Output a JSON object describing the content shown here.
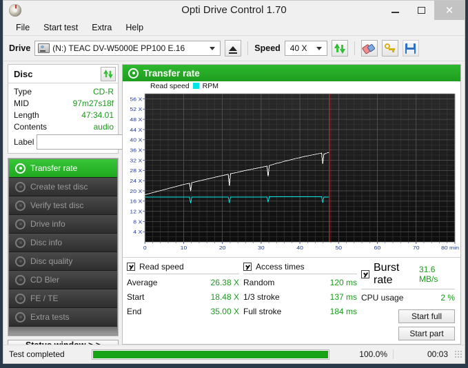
{
  "window": {
    "title": "Opti Drive Control 1.70",
    "app_icon": "cd-disc-icon",
    "minimize": "minimize-icon",
    "maximize": "maximize-icon",
    "close": "close-icon"
  },
  "menu": [
    "File",
    "Start test",
    "Extra",
    "Help"
  ],
  "toolbar": {
    "drive_label": "Drive",
    "drive_value": "(N:)   TEAC DV-W5000E PP100 E.16",
    "eject_icon": "eject-icon",
    "speed_label": "Speed",
    "speed_value": "40 X",
    "refresh_icon": "refresh-icon",
    "eraser_icon": "eraser-icon",
    "key_icon": "key-icon",
    "save_icon": "save-icon"
  },
  "disc": {
    "header": "Disc",
    "refresh_icon": "refresh-icon",
    "rows": [
      {
        "key": "Type",
        "value": "CD-R"
      },
      {
        "key": "MID",
        "value": "97m27s18f"
      },
      {
        "key": "Length",
        "value": "47:34.01"
      },
      {
        "key": "Contents",
        "value": "audio"
      }
    ],
    "label_key": "Label",
    "label_value": "",
    "label_placeholder": "",
    "cd_button_icon": "cd-disc-icon"
  },
  "sidebar": {
    "items": [
      {
        "label": "Transfer rate",
        "active": true
      },
      {
        "label": "Create test disc",
        "active": false
      },
      {
        "label": "Verify test disc",
        "active": false
      },
      {
        "label": "Drive info",
        "active": false
      },
      {
        "label": "Disc info",
        "active": false
      },
      {
        "label": "Disc quality",
        "active": false
      },
      {
        "label": "CD Bler",
        "active": false
      },
      {
        "label": "FE / TE",
        "active": false
      },
      {
        "label": "Extra tests",
        "active": false
      }
    ],
    "status_window_button": "Status window > >"
  },
  "chart_panel": {
    "title": "Transfer rate",
    "title_icon": "disc-icon"
  },
  "chart_data": {
    "type": "line",
    "title": "Transfer rate",
    "xlabel": "min",
    "ylabel": "X",
    "xlim": [
      0,
      80
    ],
    "ylim": [
      0,
      58
    ],
    "xticks": [
      0,
      10,
      20,
      30,
      40,
      50,
      60,
      70,
      80
    ],
    "xtick_labels": [
      "0",
      "10",
      "20",
      "30",
      "40",
      "50",
      "60",
      "70",
      "80 min"
    ],
    "yticks": [
      4,
      8,
      12,
      16,
      20,
      24,
      28,
      32,
      36,
      40,
      44,
      48,
      52,
      56
    ],
    "ytick_labels": [
      "4 X",
      "8 X",
      "12 X",
      "16 X",
      "20 X",
      "24 X",
      "28 X",
      "32 X",
      "36 X",
      "40 X",
      "44 X",
      "48 X",
      "52 X",
      "56 X"
    ],
    "grid": true,
    "legend_position": "top-left",
    "background": "#141414",
    "marker_line": {
      "x": 47.6,
      "color": "#e01b1b"
    },
    "series": [
      {
        "name": "Read speed",
        "color": "#ffffff",
        "points": [
          [
            0.0,
            18.5
          ],
          [
            2.0,
            19.3
          ],
          [
            4.0,
            20.1
          ],
          [
            6.0,
            20.9
          ],
          [
            8.0,
            21.7
          ],
          [
            10.0,
            22.5
          ],
          [
            11.5,
            23.0
          ],
          [
            11.8,
            19.9
          ],
          [
            12.1,
            23.2
          ],
          [
            14.0,
            23.9
          ],
          [
            16.0,
            24.6
          ],
          [
            18.0,
            25.3
          ],
          [
            20.0,
            26.0
          ],
          [
            21.5,
            26.5
          ],
          [
            21.8,
            22.0
          ],
          [
            22.1,
            26.7
          ],
          [
            24.0,
            27.3
          ],
          [
            26.0,
            28.0
          ],
          [
            28.0,
            28.6
          ],
          [
            30.0,
            29.2
          ],
          [
            31.5,
            29.7
          ],
          [
            31.8,
            25.6
          ],
          [
            32.1,
            29.9
          ],
          [
            33.0,
            30.3
          ],
          [
            34.0,
            30.8
          ],
          [
            35.0,
            31.1
          ],
          [
            36.0,
            31.6
          ],
          [
            37.0,
            31.9
          ],
          [
            38.0,
            32.3
          ],
          [
            39.0,
            32.7
          ],
          [
            40.0,
            33.0
          ],
          [
            41.0,
            33.4
          ],
          [
            42.0,
            33.7
          ],
          [
            43.0,
            34.0
          ],
          [
            44.0,
            34.3
          ],
          [
            45.0,
            34.6
          ],
          [
            45.6,
            34.8
          ],
          [
            45.9,
            30.6
          ],
          [
            46.2,
            34.4
          ],
          [
            46.8,
            34.7
          ],
          [
            47.2,
            35.0
          ],
          [
            47.5,
            35.0
          ]
        ]
      },
      {
        "name": "RPM",
        "color": "#00e5e5",
        "points": [
          [
            0.0,
            17.6
          ],
          [
            11.5,
            17.6
          ],
          [
            11.8,
            15.2
          ],
          [
            12.1,
            17.6
          ],
          [
            21.5,
            17.6
          ],
          [
            21.8,
            15.3
          ],
          [
            22.1,
            17.6
          ],
          [
            31.5,
            17.6
          ],
          [
            31.8,
            15.6
          ],
          [
            32.1,
            17.7
          ],
          [
            40.0,
            17.7
          ],
          [
            45.6,
            17.7
          ],
          [
            45.9,
            15.4
          ],
          [
            46.2,
            17.6
          ],
          [
            47.5,
            17.6
          ]
        ]
      }
    ]
  },
  "stats": {
    "read_speed": {
      "checkbox_label": "Read speed",
      "checked": true,
      "rows": [
        {
          "key": "Average",
          "value": "26.38 X"
        },
        {
          "key": "Start",
          "value": "18.48 X"
        },
        {
          "key": "End",
          "value": "35.00 X"
        }
      ]
    },
    "access_times": {
      "checkbox_label": "Access times",
      "checked": true,
      "rows": [
        {
          "key": "Random",
          "value": "120 ms"
        },
        {
          "key": "1/3 stroke",
          "value": "137 ms"
        },
        {
          "key": "Full stroke",
          "value": "184 ms"
        }
      ]
    },
    "burst": {
      "checkbox_label": "Burst rate",
      "checked": true,
      "burst_value": "31.6 MB/s",
      "cpu_key": "CPU usage",
      "cpu_value": "2 %",
      "start_full": "Start full",
      "start_part": "Start part"
    }
  },
  "statusbar": {
    "text": "Test completed",
    "progress_percent": 100,
    "progress_label": "100.0%",
    "elapsed": "00:03"
  }
}
